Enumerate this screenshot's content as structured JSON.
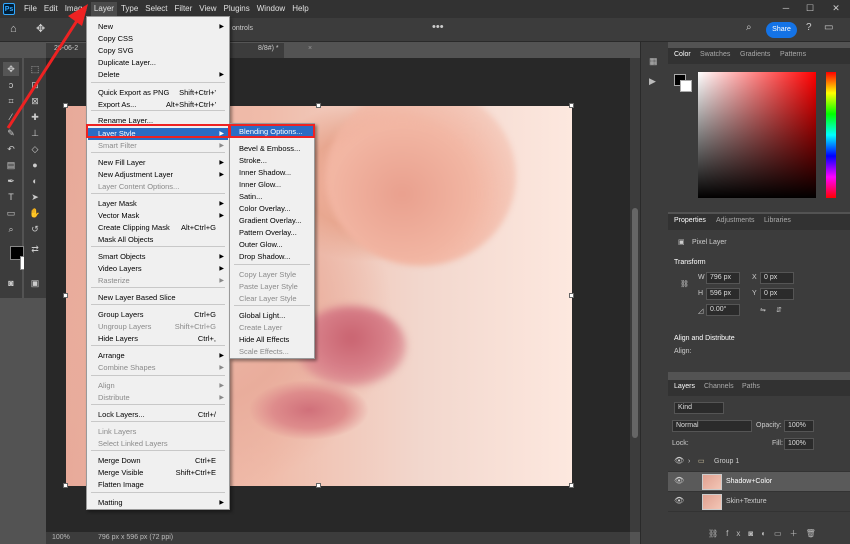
{
  "menubar": {
    "items": [
      "File",
      "Edit",
      "Image",
      "Layer",
      "Type",
      "Select",
      "Filter",
      "View",
      "Plugins",
      "Window",
      "Help"
    ],
    "active": "Layer",
    "app_icon": "Ps"
  },
  "options": {
    "share_label": "Share",
    "controls_label": "ontrols"
  },
  "doc": {
    "tab_left": "20-06-2",
    "tab_right": "8/8#) *",
    "close": "×"
  },
  "status": {
    "zoom": "100%",
    "size": "796 px x 596 px (72 ppi)"
  },
  "color_panel": {
    "tabs": [
      "Color",
      "Swatches",
      "Gradients",
      "Patterns"
    ]
  },
  "properties": {
    "tabs": [
      "Properties",
      "Adjustments",
      "Libraries"
    ],
    "kind": "Pixel Layer",
    "transform_label": "Transform",
    "w_label": "W",
    "h_label": "H",
    "w": "796 px",
    "h": "596 px",
    "x_label": "X",
    "y_label": "Y",
    "x": "0 px",
    "y": "0 px",
    "angle": "0.00°",
    "align_label": "Align and Distribute",
    "align_sub": "Align:"
  },
  "layers": {
    "tabs": [
      "Layers",
      "Channels",
      "Paths"
    ],
    "kind_filter": "Kind",
    "blend_mode": "Normal",
    "opacity_label": "Opacity:",
    "opacity": "100%",
    "lock_label": "Lock:",
    "fill_label": "Fill:",
    "fill": "100%",
    "items": [
      {
        "name": "Group 1"
      },
      {
        "name": "Shadow+Color"
      },
      {
        "name": "Skin+Texture"
      }
    ]
  },
  "layer_menu": {
    "items": [
      {
        "label": "New",
        "shortcut": "",
        "arrow": true,
        "disabled": false
      },
      {
        "label": "Copy CSS",
        "shortcut": "",
        "arrow": false,
        "disabled": false
      },
      {
        "label": "Copy SVG",
        "shortcut": "",
        "arrow": false,
        "disabled": false
      },
      {
        "label": "Duplicate Layer...",
        "shortcut": "",
        "arrow": false,
        "disabled": false
      },
      {
        "label": "Delete",
        "shortcut": "",
        "arrow": true,
        "disabled": false
      },
      {
        "label": "Quick Export as PNG",
        "shortcut": "Shift+Ctrl+'",
        "arrow": false,
        "disabled": false
      },
      {
        "label": "Export As...",
        "shortcut": "Alt+Shift+Ctrl+'",
        "arrow": false,
        "disabled": false
      },
      {
        "label": "Rename Layer...",
        "shortcut": "",
        "arrow": false,
        "disabled": false
      },
      {
        "label": "Layer Style",
        "shortcut": "",
        "arrow": true,
        "disabled": false
      },
      {
        "label": "Smart Filter",
        "shortcut": "",
        "arrow": true,
        "disabled": true
      },
      {
        "label": "New Fill Layer",
        "shortcut": "",
        "arrow": true,
        "disabled": false
      },
      {
        "label": "New Adjustment Layer",
        "shortcut": "",
        "arrow": true,
        "disabled": false
      },
      {
        "label": "Layer Content Options...",
        "shortcut": "",
        "arrow": false,
        "disabled": true
      },
      {
        "label": "Layer Mask",
        "shortcut": "",
        "arrow": true,
        "disabled": false
      },
      {
        "label": "Vector Mask",
        "shortcut": "",
        "arrow": true,
        "disabled": false
      },
      {
        "label": "Create Clipping Mask",
        "shortcut": "Alt+Ctrl+G",
        "arrow": false,
        "disabled": false
      },
      {
        "label": "Mask All Objects",
        "shortcut": "",
        "arrow": false,
        "disabled": false
      },
      {
        "label": "Smart Objects",
        "shortcut": "",
        "arrow": true,
        "disabled": false
      },
      {
        "label": "Video Layers",
        "shortcut": "",
        "arrow": true,
        "disabled": false
      },
      {
        "label": "Rasterize",
        "shortcut": "",
        "arrow": true,
        "disabled": true
      },
      {
        "label": "New Layer Based Slice",
        "shortcut": "",
        "arrow": false,
        "disabled": false
      },
      {
        "label": "Group Layers",
        "shortcut": "Ctrl+G",
        "arrow": false,
        "disabled": false
      },
      {
        "label": "Ungroup Layers",
        "shortcut": "Shift+Ctrl+G",
        "arrow": false,
        "disabled": true
      },
      {
        "label": "Hide Layers",
        "shortcut": "Ctrl+,",
        "arrow": false,
        "disabled": false
      },
      {
        "label": "Arrange",
        "shortcut": "",
        "arrow": true,
        "disabled": false
      },
      {
        "label": "Combine Shapes",
        "shortcut": "",
        "arrow": true,
        "disabled": true
      },
      {
        "label": "Align",
        "shortcut": "",
        "arrow": true,
        "disabled": true
      },
      {
        "label": "Distribute",
        "shortcut": "",
        "arrow": true,
        "disabled": true
      },
      {
        "label": "Lock Layers...",
        "shortcut": "Ctrl+/",
        "arrow": false,
        "disabled": false
      },
      {
        "label": "Link Layers",
        "shortcut": "",
        "arrow": false,
        "disabled": true
      },
      {
        "label": "Select Linked Layers",
        "shortcut": "",
        "arrow": false,
        "disabled": true
      },
      {
        "label": "Merge Down",
        "shortcut": "Ctrl+E",
        "arrow": false,
        "disabled": false
      },
      {
        "label": "Merge Visible",
        "shortcut": "Shift+Ctrl+E",
        "arrow": false,
        "disabled": false
      },
      {
        "label": "Flatten Image",
        "shortcut": "",
        "arrow": false,
        "disabled": false
      },
      {
        "label": "Matting",
        "shortcut": "",
        "arrow": true,
        "disabled": false
      }
    ]
  },
  "style_menu": {
    "items": [
      {
        "label": "Blending Options...",
        "disabled": false
      },
      {
        "label": "Bevel & Emboss...",
        "disabled": false
      },
      {
        "label": "Stroke...",
        "disabled": false
      },
      {
        "label": "Inner Shadow...",
        "disabled": false
      },
      {
        "label": "Inner Glow...",
        "disabled": false
      },
      {
        "label": "Satin...",
        "disabled": false
      },
      {
        "label": "Color Overlay...",
        "disabled": false
      },
      {
        "label": "Gradient Overlay...",
        "disabled": false
      },
      {
        "label": "Pattern Overlay...",
        "disabled": false
      },
      {
        "label": "Outer Glow...",
        "disabled": false
      },
      {
        "label": "Drop Shadow...",
        "disabled": false
      },
      {
        "label": "Copy Layer Style",
        "disabled": true
      },
      {
        "label": "Paste Layer Style",
        "disabled": true
      },
      {
        "label": "Clear Layer Style",
        "disabled": true
      },
      {
        "label": "Global Light...",
        "disabled": false
      },
      {
        "label": "Create Layer",
        "disabled": true
      },
      {
        "label": "Hide All Effects",
        "disabled": false
      },
      {
        "label": "Scale Effects...",
        "disabled": true
      }
    ]
  },
  "colors": {
    "accent": "#1473e6",
    "highlight": "#2b6cc4",
    "annotation": "#e22222"
  }
}
